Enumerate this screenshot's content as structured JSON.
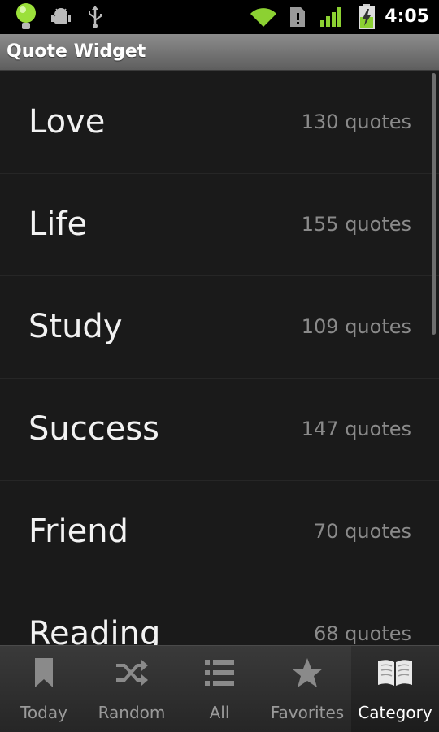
{
  "status_bar": {
    "time": "4:05",
    "icons": [
      "lightbulb-icon",
      "android-debug-icon",
      "usb-icon",
      "wifi-icon",
      "sim-card-icon",
      "signal-bars-icon",
      "battery-charging-icon"
    ],
    "accent": "#8cd132"
  },
  "app": {
    "title": "Quote Widget"
  },
  "categories": [
    {
      "name": "Love",
      "count": "130 quotes"
    },
    {
      "name": "Life",
      "count": "155 quotes"
    },
    {
      "name": "Study",
      "count": "109 quotes"
    },
    {
      "name": "Success",
      "count": "147 quotes"
    },
    {
      "name": "Friend",
      "count": "70 quotes"
    },
    {
      "name": "Reading",
      "count": "68 quotes"
    }
  ],
  "tabs": [
    {
      "label": "Today",
      "icon": "bookmark-icon"
    },
    {
      "label": "Random",
      "icon": "shuffle-icon"
    },
    {
      "label": "All",
      "icon": "list-icon"
    },
    {
      "label": "Favorites",
      "icon": "star-icon"
    },
    {
      "label": "Category",
      "icon": "book-icon",
      "active": true
    }
  ]
}
